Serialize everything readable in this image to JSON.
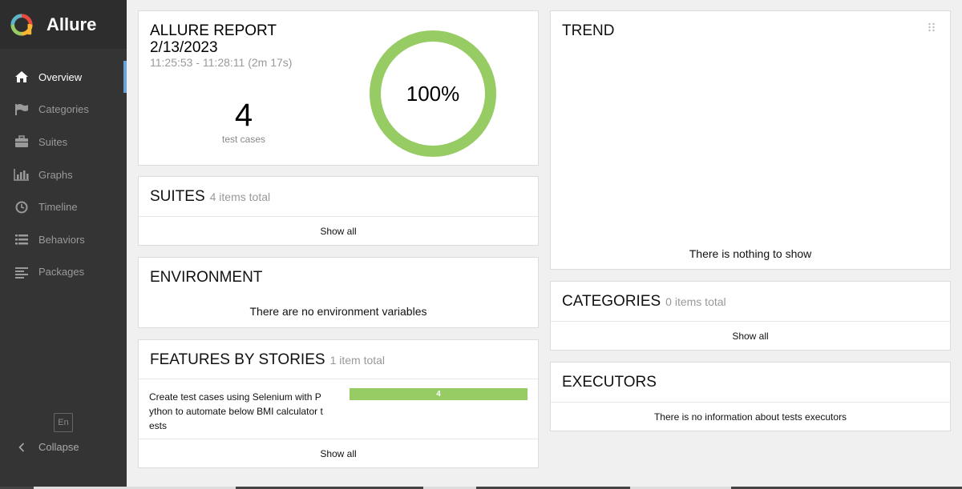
{
  "app": {
    "name": "Allure"
  },
  "sidebar": {
    "items": [
      {
        "label": "Overview",
        "icon": "home-icon",
        "active": true
      },
      {
        "label": "Categories",
        "icon": "flag-icon"
      },
      {
        "label": "Suites",
        "icon": "briefcase-icon"
      },
      {
        "label": "Graphs",
        "icon": "bar-chart-icon"
      },
      {
        "label": "Timeline",
        "icon": "clock-icon"
      },
      {
        "label": "Behaviors",
        "icon": "list-icon"
      },
      {
        "label": "Packages",
        "icon": "align-left-icon"
      }
    ],
    "language": "En",
    "collapse_label": "Collapse"
  },
  "summary": {
    "title": "ALLURE REPORT",
    "date": "2/13/2023",
    "time": "11:25:53 - 11:28:11 (2m 17s)",
    "test_count": "4",
    "test_count_label": "test cases",
    "pass_percent": "100%",
    "pass_rate": 1.0,
    "pass_color": "#97cc64"
  },
  "suites": {
    "title": "SUITES",
    "subtitle": "4 items total",
    "show_all": "Show all"
  },
  "environment": {
    "title": "ENVIRONMENT",
    "message": "There are no environment variables"
  },
  "features": {
    "title": "FEATURES BY STORIES",
    "subtitle": "1 item total",
    "rows": [
      {
        "name": "Create test cases using Selenium with P\nython to automate below BMI calculator t\nests",
        "passed": "4"
      }
    ],
    "show_all": "Show all"
  },
  "trend": {
    "title": "TREND",
    "message": "There is nothing to show"
  },
  "categories": {
    "title": "CATEGORIES",
    "subtitle": "0 items total",
    "show_all": "Show all"
  },
  "executors": {
    "title": "EXECUTORS",
    "message": "There is no information about tests executors"
  }
}
